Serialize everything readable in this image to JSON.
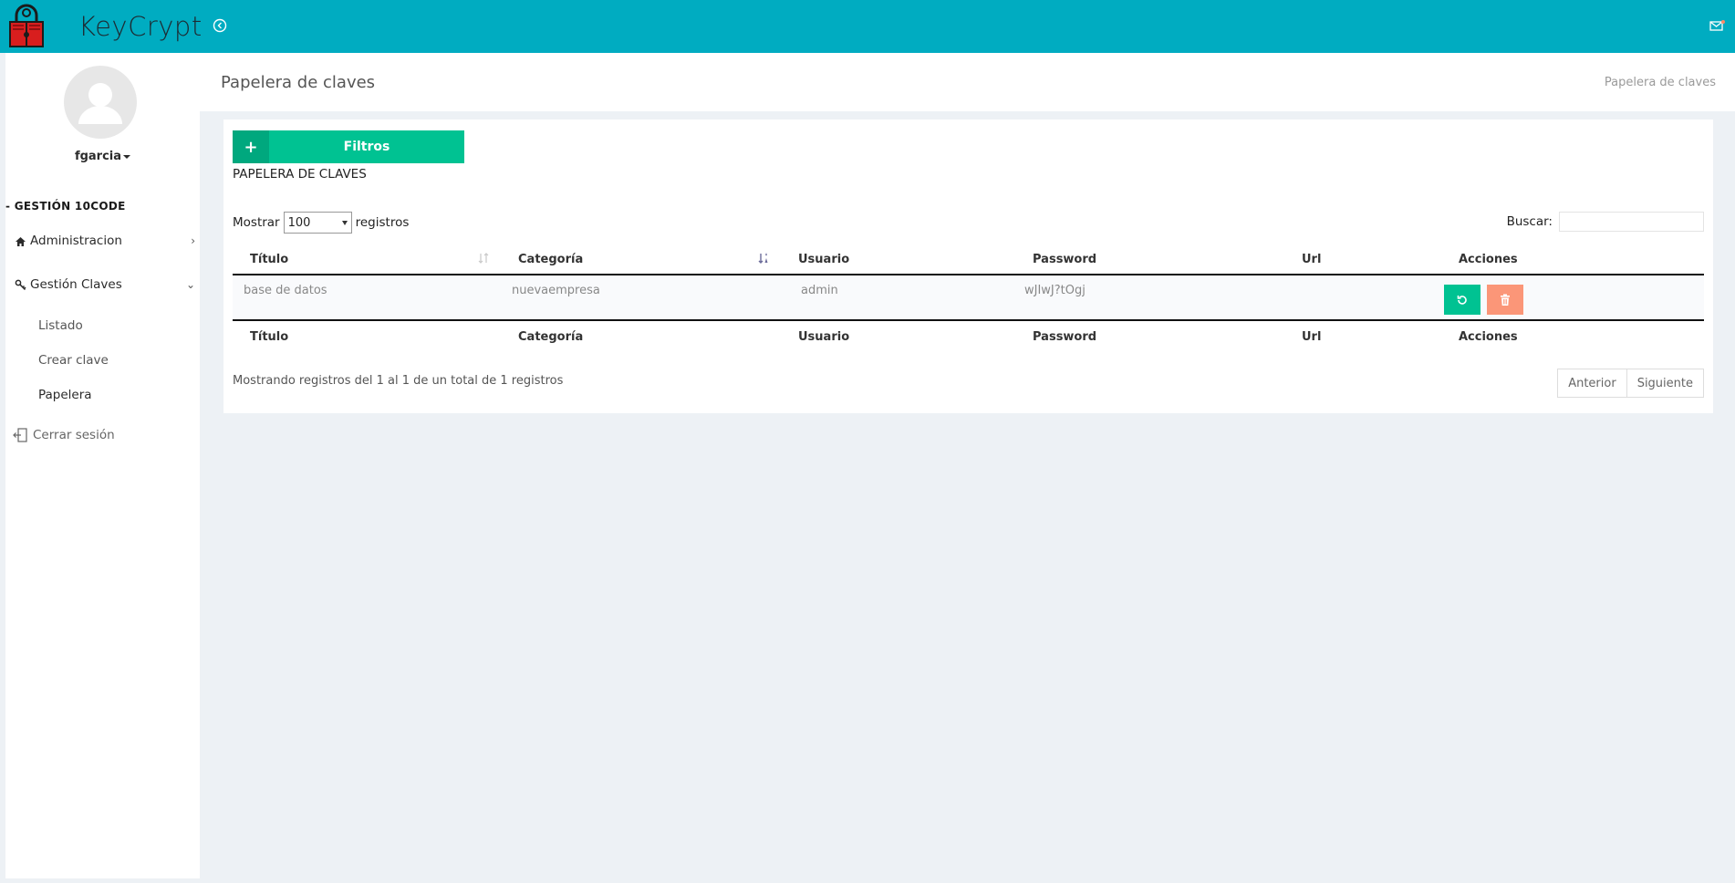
{
  "app": {
    "name": "KeyCrypt"
  },
  "user": {
    "name": "fgarcia"
  },
  "sidebar": {
    "section": "GESTIÓN 10CODE",
    "items": [
      {
        "label": "Administracion",
        "icon": "home-icon",
        "arrow": "›"
      },
      {
        "label": "Gestión Claves",
        "icon": "key-icon",
        "arrow": "⌄"
      }
    ],
    "subitems": [
      {
        "label": "Listado"
      },
      {
        "label": "Crear clave"
      },
      {
        "label": "Papelera"
      }
    ],
    "logout": "Cerrar sesión"
  },
  "page": {
    "title": "Papelera de claves",
    "breadcrumb": "Papelera de claves"
  },
  "filters": {
    "plus": "+",
    "label": "Filtros"
  },
  "list": {
    "title": "PAPELERA DE CLAVES",
    "show_prefix": "Mostrar",
    "show_value": "100",
    "show_suffix": "registros",
    "search_label": "Buscar:",
    "search_value": ""
  },
  "table": {
    "columns": [
      "Título",
      "Categoría",
      "Usuario",
      "Password",
      "Url",
      "Acciones"
    ],
    "rows": [
      {
        "titulo": "base de datos",
        "categoria": "nuevaempresa",
        "usuario": "admin",
        "password": "wJIwJ?tOgj",
        "url": ""
      }
    ]
  },
  "pagination": {
    "info": "Mostrando registros del 1 al 1 de un total de 1 registros",
    "prev": "Anterior",
    "next": "Siguiente"
  },
  "colors": {
    "topbar": "#00acc1",
    "success": "#00c292",
    "danger": "#fb9678"
  }
}
